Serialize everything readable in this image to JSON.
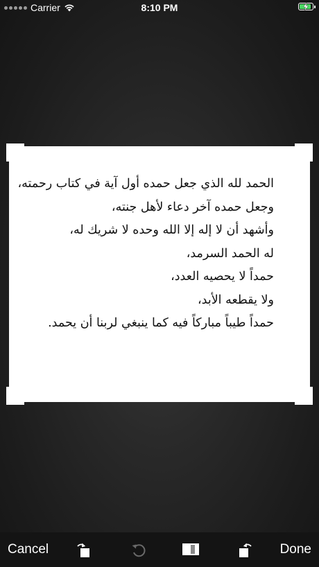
{
  "status_bar": {
    "carrier": "Carrier",
    "time": "8:10 PM",
    "battery_level": 0.9,
    "icons": [
      "signal-dots-icon",
      "wifi-icon",
      "battery-charging-icon"
    ]
  },
  "document": {
    "lines": [
      "الحمد لله الذي جعل حمده أول آية في كتاب رحمته،",
      "وجعل حمده آخر دعاء لأهل جنته،",
      "وأشهد أن لا إله إلا الله وحده لا شريك له،",
      "له الحمد السرمد،",
      "حمداً لا يحصيه العدد،",
      "ولا يقطعه الأبد،",
      "حمداً طيباً مباركاً فيه كما ينبغي لربنا أن يحمد."
    ]
  },
  "toolbar": {
    "cancel_label": "Cancel",
    "done_label": "Done",
    "icons": [
      "rotate-left-icon",
      "reset-icon",
      "aspect-ratio-icon",
      "rotate-right-icon"
    ]
  },
  "colors": {
    "background": "#1e1e1e",
    "toolbar": "#141414",
    "battery_fill": "#4cd964",
    "disabled_icon": "#6a6a6a"
  }
}
